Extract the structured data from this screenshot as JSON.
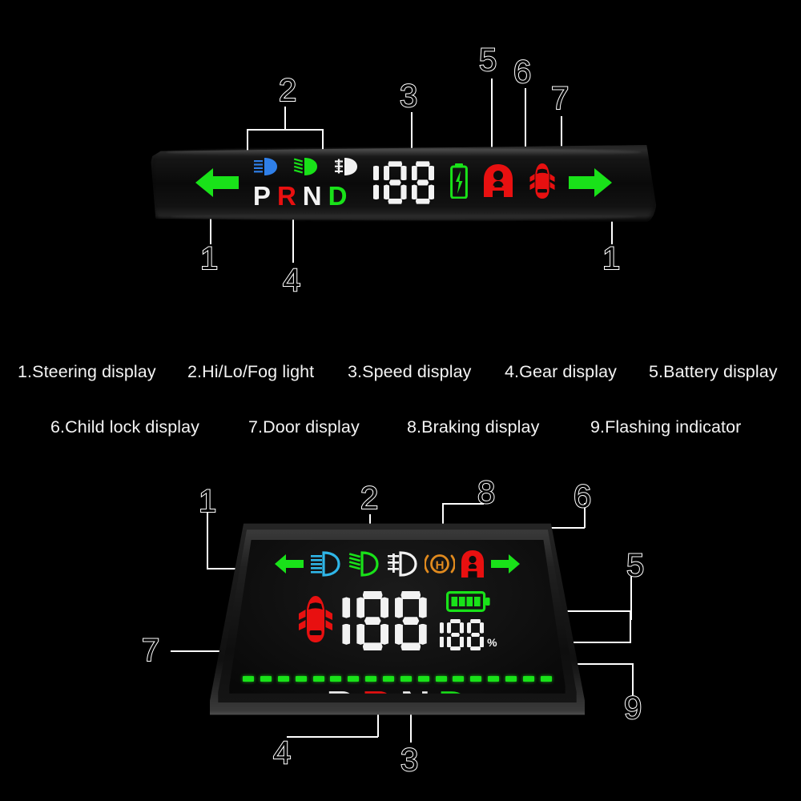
{
  "page": {
    "background": "#000000",
    "title": "HUD head-up display feature callout diagram"
  },
  "colors": {
    "green": "#19e219",
    "red": "#e81010",
    "cyan": "#2fb6e8",
    "blue": "#2f7fe8",
    "white": "#f2f2f2",
    "orange": "#e08a1e",
    "outline": "#ffffff"
  },
  "legend": {
    "row1": [
      "1.Steering display",
      "2.Hi/Lo/Fog light",
      "3.Speed display",
      "4.Gear display",
      "5.Battery display"
    ],
    "row2": [
      "6.Child lock display",
      "7.Door display",
      "8.Braking display",
      "9.Flashing indicator"
    ]
  },
  "device1": {
    "name": "slim-bar-hud",
    "speed_value": "188",
    "gear_letters": [
      {
        "letter": "P",
        "color": "#f2f2f2"
      },
      {
        "letter": "R",
        "color": "#e81010"
      },
      {
        "letter": "N",
        "color": "#f2f2f2"
      },
      {
        "letter": "D",
        "color": "#19e219"
      }
    ],
    "icons": [
      {
        "name": "turn-left-arrow-icon",
        "color": "#19e219"
      },
      {
        "name": "high-beam-icon",
        "color": "#2f7fe8"
      },
      {
        "name": "low-beam-icon",
        "color": "#19e219"
      },
      {
        "name": "fog-light-icon",
        "color": "#f2f2f2"
      },
      {
        "name": "battery-charging-icon",
        "color": "#19e219"
      },
      {
        "name": "child-lock-icon",
        "color": "#e81010"
      },
      {
        "name": "door-open-car-icon",
        "color": "#e81010"
      },
      {
        "name": "turn-right-arrow-icon",
        "color": "#19e219"
      }
    ],
    "callouts": [
      {
        "label": "2",
        "target": "hi-lo-fog-light-group"
      },
      {
        "label": "3",
        "target": "speed-display"
      },
      {
        "label": "5",
        "target": "battery-display"
      },
      {
        "label": "6",
        "target": "child-lock-display"
      },
      {
        "label": "7",
        "target": "door-display"
      },
      {
        "label": "1",
        "target": "steering-left-arrow"
      },
      {
        "label": "4",
        "target": "gear-display"
      },
      {
        "label": "1",
        "target": "steering-right-arrow"
      }
    ]
  },
  "device2": {
    "name": "hud-box",
    "speed_value": "188",
    "battery_percent_value": "188",
    "battery_percent_unit": "%",
    "battery_bars": 4,
    "gear_letters": [
      {
        "letter": "P",
        "color": "#f2f2f2"
      },
      {
        "letter": "R",
        "color": "#e81010"
      },
      {
        "letter": "N",
        "color": "#f2f2f2"
      },
      {
        "letter": "D",
        "color": "#19e219"
      }
    ],
    "flashing_indicator_segments": 18,
    "icons": [
      {
        "name": "turn-left-arrow-icon",
        "color": "#19e219"
      },
      {
        "name": "high-beam-icon",
        "color": "#2fb6e8"
      },
      {
        "name": "low-beam-icon",
        "color": "#19e219"
      },
      {
        "name": "fog-light-icon",
        "color": "#f2f2f2"
      },
      {
        "name": "brake-handbrake-icon",
        "color": "#e08a1e",
        "glyph": "H"
      },
      {
        "name": "child-lock-icon",
        "color": "#e81010"
      },
      {
        "name": "turn-right-arrow-icon",
        "color": "#19e219"
      },
      {
        "name": "door-open-car-icon",
        "color": "#e81010"
      }
    ],
    "callouts": [
      {
        "label": "1",
        "target": "steering-display"
      },
      {
        "label": "2",
        "target": "hi-lo-fog-light-group"
      },
      {
        "label": "8",
        "target": "braking-display"
      },
      {
        "label": "6",
        "target": "child-lock-display"
      },
      {
        "label": "5",
        "target": "battery-display"
      },
      {
        "label": "9",
        "target": "flashing-indicator"
      },
      {
        "label": "7",
        "target": "door-display"
      },
      {
        "label": "4",
        "target": "gear-display"
      },
      {
        "label": "3",
        "target": "speed-display"
      }
    ]
  }
}
